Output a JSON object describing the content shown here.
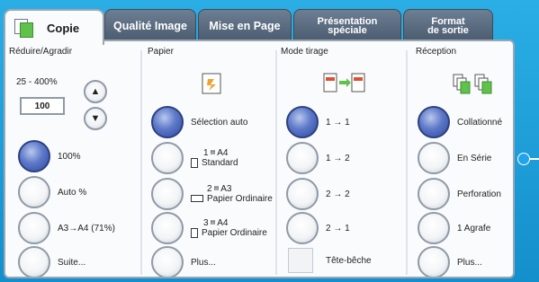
{
  "tabs": [
    {
      "label": "Copie",
      "active": true
    },
    {
      "label": "Qualité Image"
    },
    {
      "label": "Mise en Page"
    },
    {
      "label": "Présentation\nspéciale"
    },
    {
      "label": "Format\nde sortie"
    }
  ],
  "reduce": {
    "header": "Réduire/Agradir",
    "range": "25 - 400%",
    "value": "100",
    "up_glyph": "▲",
    "down_glyph": "▼",
    "options": [
      {
        "label": "100%",
        "selected": true
      },
      {
        "label": "Auto %"
      },
      {
        "label": "A3→A4 (71%)"
      },
      {
        "label": "Suite..."
      }
    ]
  },
  "paper": {
    "header": "Papier",
    "options": [
      {
        "label": "Sélection auto",
        "selected": true
      },
      {
        "tray": "1",
        "size": "A4",
        "type": "Standard"
      },
      {
        "tray": "2",
        "size": "A3",
        "type": "Papier Ordinaire"
      },
      {
        "tray": "3",
        "size": "A4",
        "type": "Papier Ordinaire"
      },
      {
        "label": "Plus..."
      }
    ]
  },
  "mode": {
    "header": "Mode tirage",
    "options": [
      {
        "label": "1 → 1",
        "selected": true
      },
      {
        "label": "1 → 2"
      },
      {
        "label": "2 → 2"
      },
      {
        "label": "2 → 1"
      },
      {
        "label": "Tête-bêche"
      }
    ]
  },
  "reception": {
    "header": "Réception",
    "options": [
      {
        "label": "Collationné",
        "selected": true
      },
      {
        "label": "En Série"
      },
      {
        "label": "Perforation"
      },
      {
        "label": "1 Agrafe"
      },
      {
        "label": "Plus..."
      }
    ]
  },
  "icons": {
    "copy_tab": "copy-icon",
    "paper_tray": "paper-tray-icon",
    "duplex": "duplex-icon",
    "collate": "collate-icon",
    "callout": "callout-pointer-icon"
  },
  "colors": {
    "background": "#1f9fd8",
    "tab_inactive": "#4b5b6e",
    "radio_selected": "#2d4aa2",
    "accent_green": "#5fc24a"
  }
}
